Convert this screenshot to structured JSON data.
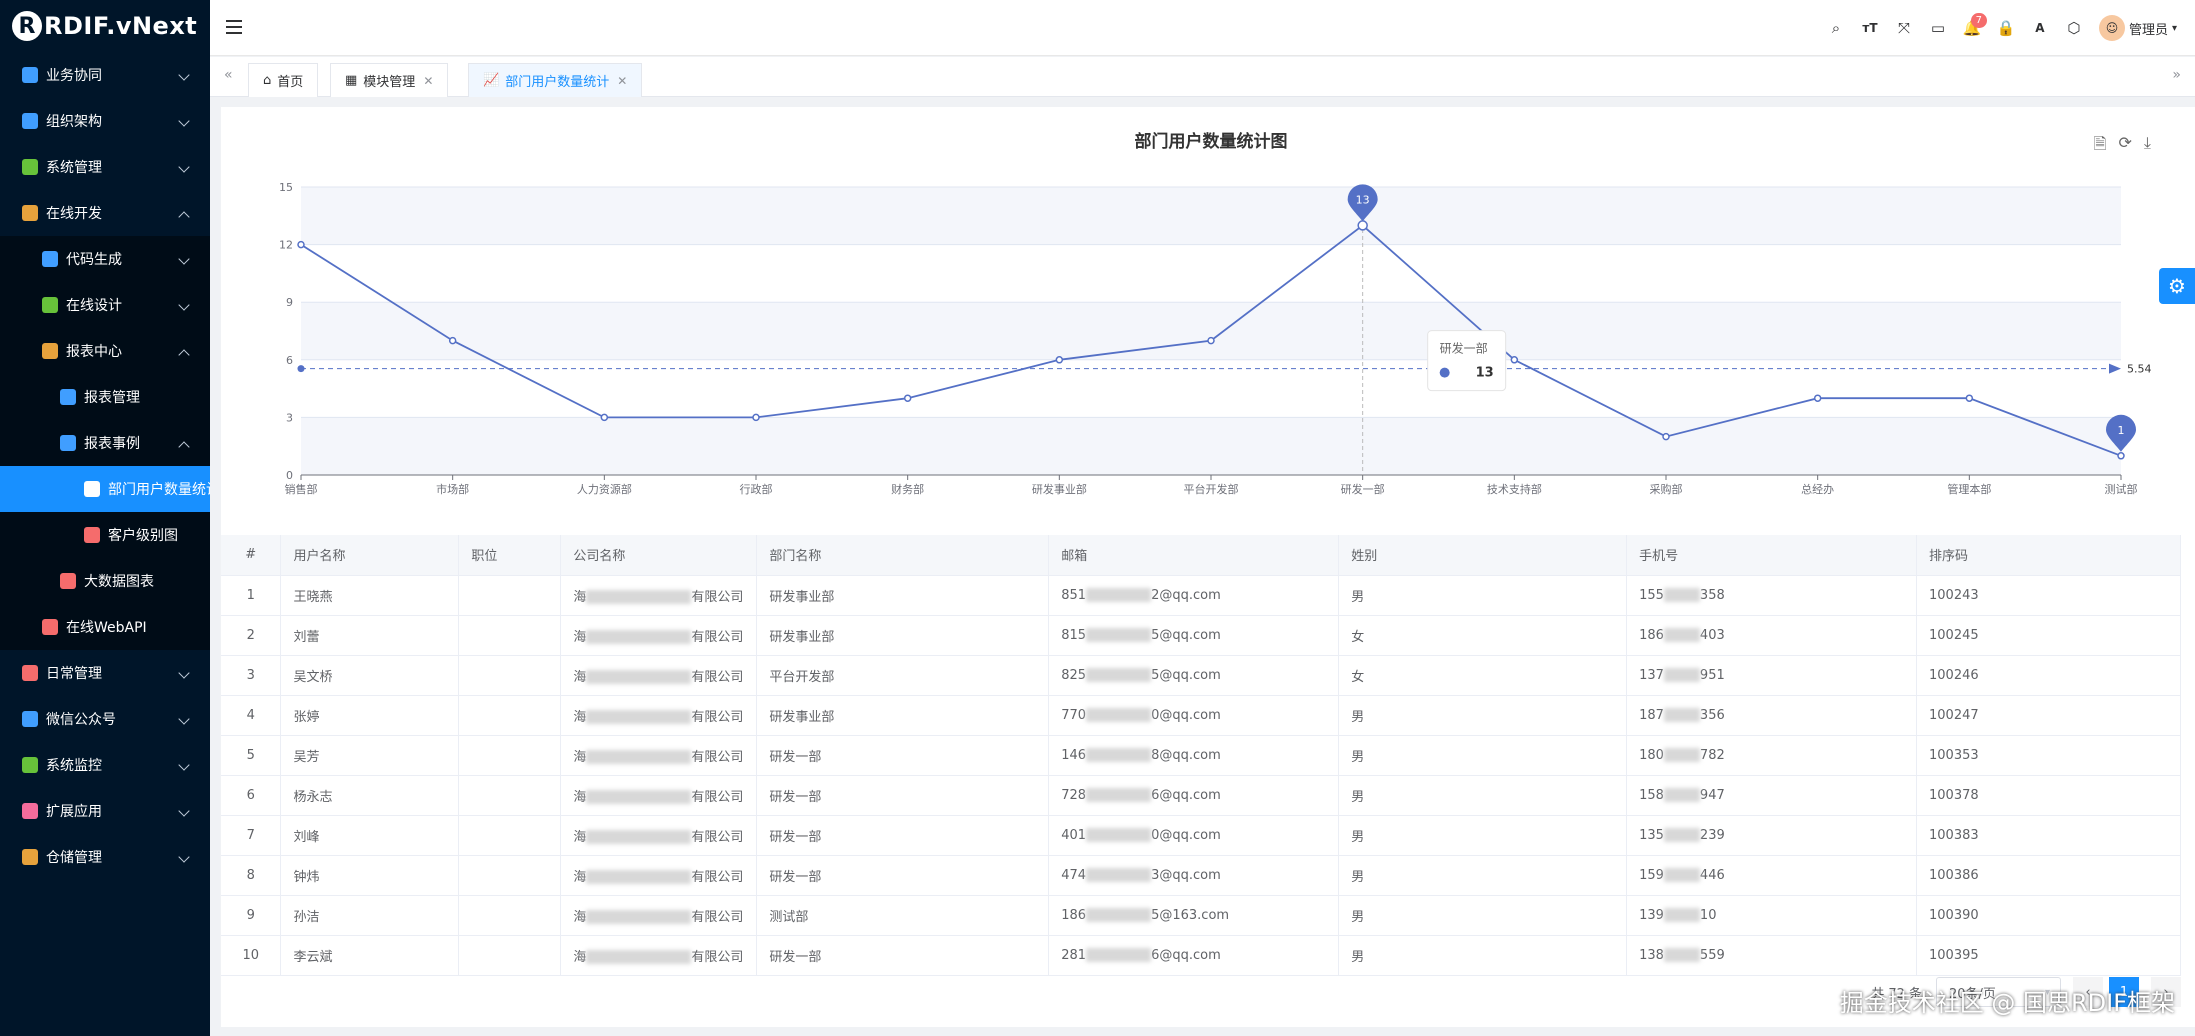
{
  "brand": {
    "logo_letter": "R",
    "name": "RDIF.vNext"
  },
  "sidebar": [
    {
      "label": "业务协同",
      "level": 1,
      "state": "collapsed",
      "icon": "briefcase-icon",
      "color": "#409eff"
    },
    {
      "label": "组织架构",
      "level": 1,
      "state": "collapsed",
      "icon": "org-icon",
      "color": "#409eff"
    },
    {
      "label": "系统管理",
      "level": 1,
      "state": "collapsed",
      "icon": "gear-icon",
      "color": "#67c23a"
    },
    {
      "label": "在线开发",
      "level": 1,
      "state": "expanded",
      "icon": "grid-icon",
      "color": "#e6a23c"
    },
    {
      "label": "代码生成",
      "level": 2,
      "state": "collapsed",
      "icon": "code-file-icon",
      "color": "#409eff"
    },
    {
      "label": "在线设计",
      "level": 2,
      "state": "collapsed",
      "icon": "design-icon",
      "color": "#67c23a"
    },
    {
      "label": "报表中心",
      "level": 2,
      "state": "expanded",
      "icon": "report-icon",
      "color": "#e6a23c"
    },
    {
      "label": "报表管理",
      "level": 3,
      "state": "none",
      "icon": "report-manage-icon",
      "color": "#409eff"
    },
    {
      "label": "报表事例",
      "level": 3,
      "state": "expanded",
      "icon": "report-example-icon",
      "color": "#409eff"
    },
    {
      "label": "部门用户数量统计",
      "level": 4,
      "state": "active",
      "icon": "line-chart-icon",
      "color": "#ffffff"
    },
    {
      "label": "客户级别图",
      "level": 4,
      "state": "none",
      "icon": "bar-chart-icon",
      "color": "#f56c6c"
    },
    {
      "label": "大数据图表",
      "level": 3,
      "state": "none",
      "icon": "big-data-icon",
      "color": "#f56c6c"
    },
    {
      "label": "在线WebAPI",
      "level": 2,
      "state": "none",
      "icon": "webapi-icon",
      "color": "#f56c6c"
    },
    {
      "label": "日常管理",
      "level": 1,
      "state": "collapsed",
      "icon": "calendar-icon",
      "color": "#f56c6c"
    },
    {
      "label": "微信公众号",
      "level": 1,
      "state": "collapsed",
      "icon": "wechat-icon",
      "color": "#409eff"
    },
    {
      "label": "系统监控",
      "level": 1,
      "state": "collapsed",
      "icon": "monitor-icon",
      "color": "#67c23a"
    },
    {
      "label": "扩展应用",
      "level": 1,
      "state": "collapsed",
      "icon": "apps-icon",
      "color": "#f56c9c"
    },
    {
      "label": "仓储管理",
      "level": 1,
      "state": "collapsed",
      "icon": "warehouse-icon",
      "color": "#e6a23c"
    }
  ],
  "header": {
    "notify_count": "7",
    "user": "管理员"
  },
  "tabs": [
    {
      "label": "首页",
      "icon": "home-icon",
      "closable": false,
      "active": false
    },
    {
      "label": "模块管理",
      "icon": "module-icon",
      "closable": true,
      "active": false
    },
    {
      "label": "部门用户数量统计",
      "icon": "line-chart-icon",
      "closable": true,
      "active": true
    }
  ],
  "chart_data": {
    "type": "line",
    "title": "部门用户数量统计图",
    "categories": [
      "销售部",
      "市场部",
      "人力资源部",
      "行政部",
      "财务部",
      "研发事业部",
      "平台开发部",
      "研发一部",
      "技术支持部",
      "采购部",
      "总经办",
      "管理本部",
      "测试部"
    ],
    "values": [
      12,
      7,
      3,
      3,
      4,
      6,
      7,
      13,
      6,
      2,
      4,
      4,
      1
    ],
    "ylim": [
      0,
      15
    ],
    "yticks": [
      0,
      3,
      6,
      9,
      12,
      15
    ],
    "mark_point_max": "13",
    "mark_point_min": "1",
    "average": "5.54",
    "tooltip": {
      "category": "研发一部",
      "value": "13"
    },
    "grid": true,
    "color": "#5470c6"
  },
  "table": {
    "columns": [
      "#",
      "用户名称",
      "职位",
      "公司名称",
      "部门名称",
      "邮箱",
      "姓别",
      "手机号",
      "排序码"
    ],
    "rows": [
      [
        "1",
        "王晓燕",
        "",
        "海",
        "有限公司",
        "研发事业部",
        "851",
        "2@qq.com",
        "男",
        "155",
        "358",
        "100243"
      ],
      [
        "2",
        "刘蕾",
        "",
        "海",
        "有限公司",
        "研发事业部",
        "815",
        "5@qq.com",
        "女",
        "186",
        "403",
        "100245"
      ],
      [
        "3",
        "吴文桥",
        "",
        "海",
        "有限公司",
        "平台开发部",
        "825",
        "5@qq.com",
        "女",
        "137",
        "951",
        "100246"
      ],
      [
        "4",
        "张婷",
        "",
        "海",
        "有限公司",
        "研发事业部",
        "770",
        "0@qq.com",
        "男",
        "187",
        "356",
        "100247"
      ],
      [
        "5",
        "吴芳",
        "",
        "海",
        "有限公司",
        "研发一部",
        "146",
        "8@qq.com",
        "男",
        "180",
        "782",
        "100353"
      ],
      [
        "6",
        "杨永志",
        "",
        "海",
        "有限公司",
        "研发一部",
        "728",
        "6@qq.com",
        "男",
        "158",
        "947",
        "100378"
      ],
      [
        "7",
        "刘峰",
        "",
        "海",
        "有限公司",
        "研发一部",
        "401",
        "0@qq.com",
        "男",
        "135",
        "239",
        "100383"
      ],
      [
        "8",
        "钟炜",
        "",
        "海",
        "有限公司",
        "研发一部",
        "474",
        "3@qq.com",
        "男",
        "159",
        "446",
        "100386"
      ],
      [
        "9",
        "孙洁",
        "",
        "海",
        "有限公司",
        "测试部",
        "186",
        "5@163.com",
        "男",
        "139",
        "10",
        "100390"
      ],
      [
        "10",
        "李云斌",
        "",
        "海",
        "有限公司",
        "研发一部",
        "281",
        "6@qq.com",
        "男",
        "138",
        "559",
        "100395"
      ]
    ]
  },
  "pager": {
    "total": "共 72 条",
    "page_size": "20条/页",
    "current": "1"
  },
  "watermark": "掘金技术社区 @ 国思RDIF框架"
}
